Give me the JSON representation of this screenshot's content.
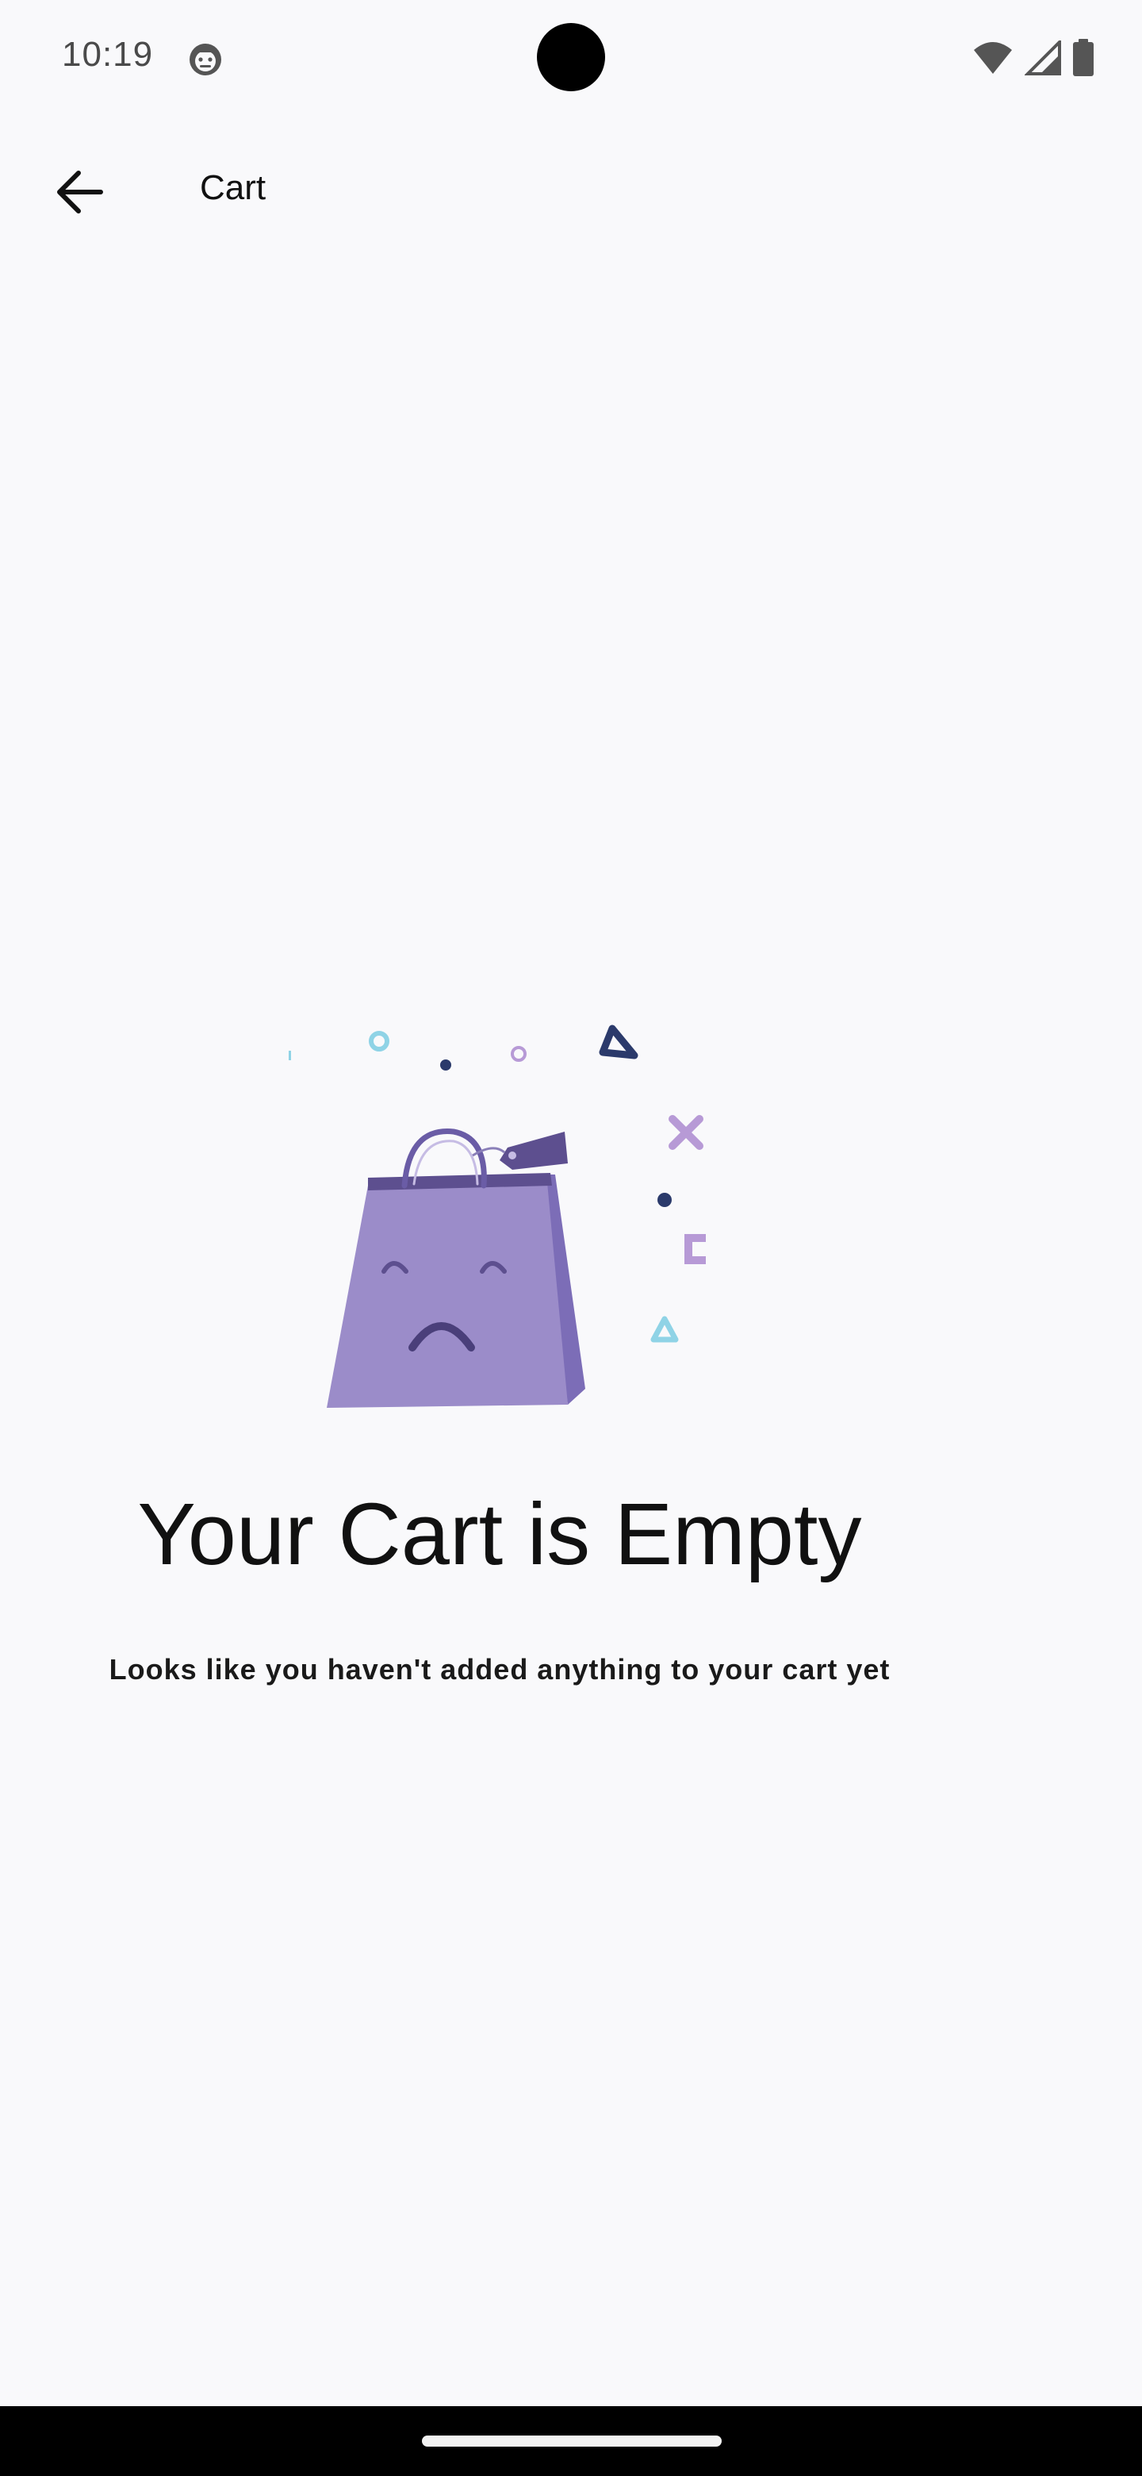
{
  "status_bar": {
    "time": "10:19",
    "icons": [
      "android-debug-icon",
      "wifi-icon",
      "cellular-signal-icon",
      "battery-icon"
    ]
  },
  "app_bar": {
    "title": "Cart",
    "back_icon": "arrow-back-icon"
  },
  "empty_state": {
    "illustration": "sad-shopping-bag-illustration",
    "title": "Your Cart is Empty",
    "subtitle": "Looks like you haven't added anything to your cart yet"
  },
  "colors": {
    "background": "#f9f9fb",
    "bag_fill": "#9b8cc9",
    "bag_dark": "#5d4f8f",
    "accent_navy": "#2b3a6b",
    "accent_lilac": "#b79ad6",
    "accent_cyan": "#8fd3e6"
  }
}
